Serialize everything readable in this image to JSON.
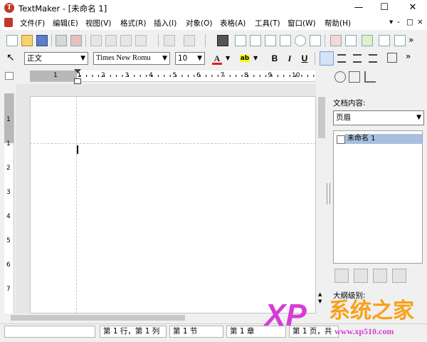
{
  "window": {
    "logo_letter": "T",
    "title": "TextMaker - [未命名 1]",
    "minimize": "—",
    "maximize": "☐",
    "close": "✕"
  },
  "menu": {
    "items": [
      "文件(F)",
      "编辑(E)",
      "视图(V)",
      "格式(R)",
      "插入(I)",
      "对象(O)",
      "表格(A)",
      "工具(T)",
      "窗口(W)",
      "帮助(H)"
    ],
    "right_controls": [
      "▾",
      "-",
      "□",
      "×"
    ]
  },
  "toolbar": {
    "style": "正文",
    "font": "Times New Romu",
    "size": "10",
    "bold": "B",
    "italic": "I",
    "underline": "U",
    "font_color_letter": "A",
    "highlight_letter": "ab"
  },
  "ruler": {
    "h_labels": [
      "1",
      "1",
      "2",
      "3",
      "4",
      "5",
      "6",
      "7",
      "8",
      "9",
      "10"
    ],
    "v_labels": [
      "1",
      "1",
      "2",
      "3",
      "4",
      "5",
      "6",
      "7"
    ]
  },
  "sidepane": {
    "label": "文档内容:",
    "dropdown": "页眉",
    "tree_item": "未命名 1",
    "outline_label": "大纲级别:"
  },
  "status": {
    "position": "第 1 行，第 1 列",
    "section": "第 1 节",
    "chapter": "第 1 章",
    "page_partial": "第 1 页，共"
  },
  "watermark": {
    "xp": "XP",
    "brand": "系统之家",
    "url": "www.xp510.com"
  },
  "colors": {
    "accent_blue": "#2b5fb4",
    "font_color_red": "#e02020",
    "highlight_yellow": "#ffff00",
    "watermark_magenta": "#d63cd6",
    "watermark_orange": "#f7a21a"
  },
  "icons": {
    "toolbar1": [
      "new-icon",
      "open-icon",
      "save-icon",
      "print-icon",
      "print-preview-icon",
      "cut-icon",
      "copy-icon",
      "paste-icon",
      "undo-icon",
      "redo-icon",
      "binoculars-icon",
      "page-view-icon",
      "outline-view-icon",
      "master-view-icon",
      "zoom-icon",
      "fullscreen-icon",
      "table-icon",
      "textframe-icon",
      "spellcheck-icon",
      "chart-icon",
      "draw-icon"
    ],
    "toolbar2": [
      "pointer-icon",
      "align-left-icon",
      "align-center-icon",
      "align-right-icon",
      "justify-icon",
      "more-icon"
    ],
    "sidepane": [
      "navigate-icon",
      "pane-option-icon",
      "chart-pane-icon"
    ]
  }
}
